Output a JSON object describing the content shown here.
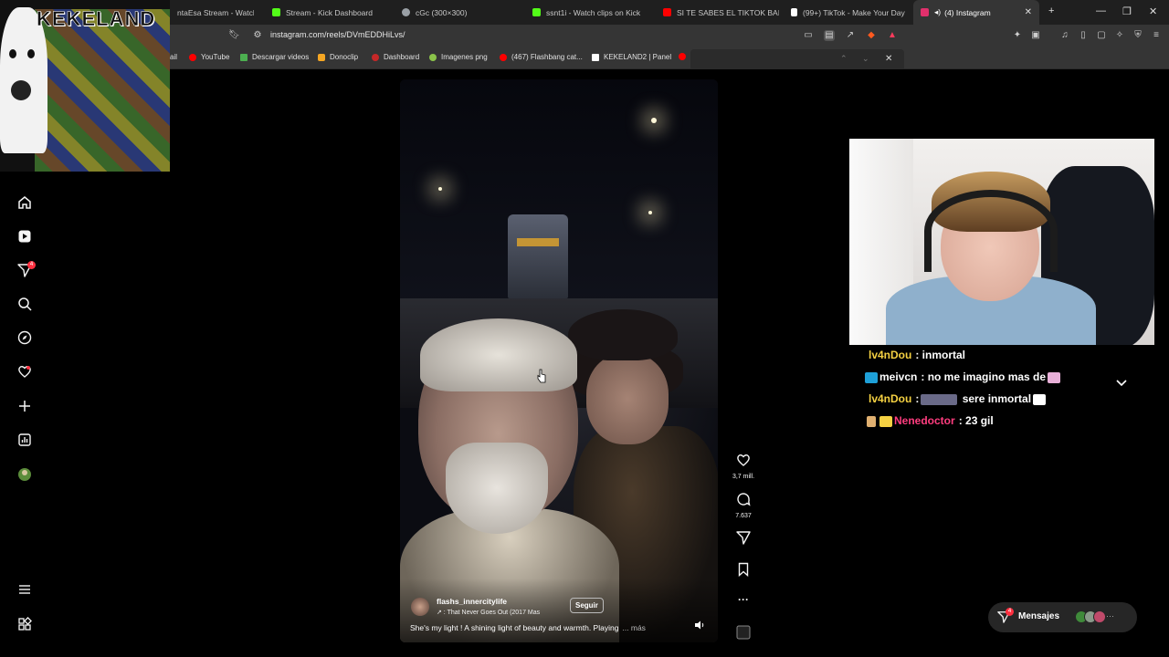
{
  "browser": {
    "tabs": [
      {
        "title": "ntaEsa Stream - Watch Li",
        "favicon_color": "#6441a5"
      },
      {
        "title": "Stream - Kick Dashboard",
        "favicon_color": "#53fc18"
      },
      {
        "title": "cGc (300×300)",
        "favicon_color": "#9aa0a6"
      },
      {
        "title": "ssnt1i - Watch clips on Kick",
        "favicon_color": "#53fc18"
      },
      {
        "title": "SI TE SABES EL TIKTOK BAILA!",
        "favicon_color": "#ff0000"
      },
      {
        "title": "(99+) TikTok - Make Your Day",
        "favicon_color": "#ffffff"
      },
      {
        "title": "(4) Instagram",
        "favicon_color": "#e1306c",
        "active": true
      }
    ],
    "url": "instagram.com/reels/DVmEDDHiLvs/",
    "bookmarks": [
      {
        "label": "ail",
        "color": "#ea4335"
      },
      {
        "label": "YouTube",
        "color": "#ff0000"
      },
      {
        "label": "Descargar videos",
        "color": "#4caf50"
      },
      {
        "label": "Donoclip",
        "color": "#f5a623"
      },
      {
        "label": "Dashboard",
        "color": "#c62828"
      },
      {
        "label": "Imagenes png",
        "color": "#8bc34a"
      },
      {
        "label": "(467) Flashbang cat...",
        "color": "#ff0000"
      },
      {
        "label": "KEKELAND2 | Panel",
        "color": "#ffffff"
      }
    ]
  },
  "overlay": {
    "title": "KEKELAND"
  },
  "instagram": {
    "sidebar_badges": {
      "reels_notifications": "4"
    },
    "reel": {
      "author": "flashs_innercitylife",
      "audio": "That Never Goes Out (2017 Mas",
      "follow_label": "Seguir",
      "caption": "She's my light ! A shining light of beauty and warmth. Playing",
      "more_label": "... más"
    },
    "actions": {
      "likes": "3,7 mill.",
      "comments": "7.637"
    },
    "messages": {
      "label": "Mensajes",
      "badge": "4"
    }
  },
  "chat": [
    {
      "user": "lv4nDou",
      "user_color": "#f5d142",
      "message": ": inmortal"
    },
    {
      "user": "meivcn",
      "user_color": "#ffffff",
      "message": ": no me imagino mas de"
    },
    {
      "user": "lv4nDou",
      "user_color": "#f5d142",
      "message": ":",
      "message2": "sere inmortal"
    },
    {
      "user": "Nenedoctor",
      "user_color": "#ff3d7f",
      "message": ": 23 gil"
    }
  ]
}
